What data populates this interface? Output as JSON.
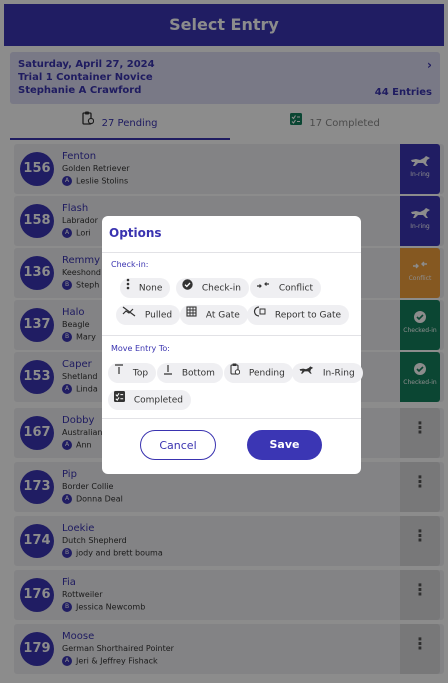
{
  "header": {
    "title": "Select Entry"
  },
  "trial": {
    "date": "Saturday, April 27, 2024",
    "name": "Trial 1  Container Novice",
    "judge": "Stephanie A Crawford",
    "entries": "44 Entries"
  },
  "tabs": {
    "pending": "27 Pending",
    "completed": "17 Completed"
  },
  "entries": [
    {
      "number": "156",
      "name": "Fenton",
      "breed": "Golden Retriever",
      "level": "A",
      "handler": "Leslie Stolins",
      "status": "In-ring"
    },
    {
      "number": "158",
      "name": "Flash",
      "breed": "Labrador",
      "level": "A",
      "handler": "Lori",
      "status": "In-ring"
    },
    {
      "number": "136",
      "name": "Remmy",
      "breed": "Keeshond",
      "level": "B",
      "handler": "Steph",
      "status": "Conflict"
    },
    {
      "number": "137",
      "name": "Halo",
      "breed": "Beagle",
      "level": "B",
      "handler": "Mary",
      "status": "Checked-in"
    },
    {
      "number": "153",
      "name": "Caper",
      "breed": "Shetland",
      "level": "A",
      "handler": "Linda",
      "status": "Checked-in"
    },
    {
      "number": "167",
      "name": "Dobby",
      "breed": "Australian",
      "level": "A",
      "handler": "Ann",
      "status": ""
    },
    {
      "number": "173",
      "name": "Pip",
      "breed": "Border Collie",
      "level": "A",
      "handler": "Donna Deal",
      "status": ""
    },
    {
      "number": "174",
      "name": "Loekie",
      "breed": "Dutch Shepherd",
      "level": "B",
      "handler": "jody and brett bouma",
      "status": ""
    },
    {
      "number": "176",
      "name": "Fia",
      "breed": "Rottweiler",
      "level": "B",
      "handler": "Jessica Newcomb",
      "status": ""
    },
    {
      "number": "179",
      "name": "Moose",
      "breed": "German Shorthaired Pointer",
      "level": "A",
      "handler": "Jeri & Jeffrey Fishack",
      "status": ""
    }
  ],
  "modal": {
    "title": "Options",
    "checkin_title": "Check-in:",
    "checkin": [
      "None",
      "Check-in",
      "Conflict",
      "Pulled",
      "At Gate",
      "Report to Gate"
    ],
    "move_title": "Move Entry To:",
    "move": [
      "Top",
      "Bottom",
      "Pending",
      "In-Ring",
      "Completed"
    ],
    "cancel": "Cancel",
    "save": "Save"
  },
  "colors": {
    "primary": "#3b36b4",
    "conflict": "#f2a03c",
    "checked_in": "#14805e",
    "background": "#efeff2"
  },
  "icons": {
    "tab_pending": "clipboard-clock-icon",
    "tab_completed": "completed-list-icon",
    "in_ring": "running-dog-icon",
    "conflict": "conflict-arrows-icon",
    "checked_in": "check-circle-icon",
    "menu": "vertical-dots-icon"
  }
}
